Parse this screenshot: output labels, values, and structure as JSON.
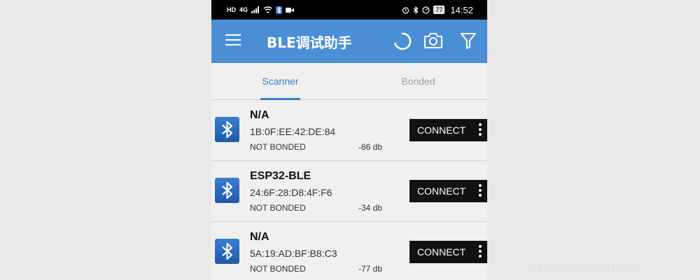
{
  "statusbar": {
    "left_badge": "HD",
    "network": "4G",
    "battery": "77",
    "time": "14:52"
  },
  "appbar": {
    "title": "BLE调试助手",
    "icons": [
      "menu-icon",
      "refresh-spinner-icon",
      "camera-icon",
      "filter-icon"
    ]
  },
  "tabs": [
    {
      "label": "Scanner",
      "active": true
    },
    {
      "label": "Bonded",
      "active": false
    }
  ],
  "devices": [
    {
      "name": "N/A",
      "mac": "1B:0F:EE:42:DE:84",
      "bond": "NOT BONDED",
      "rssi": "-86 db",
      "action": "CONNECT"
    },
    {
      "name": "ESP32-BLE",
      "mac": "24:6F:28:D8:4F:F6",
      "bond": "NOT BONDED",
      "rssi": "-34 db",
      "action": "CONNECT"
    },
    {
      "name": "N/A",
      "mac": "5A:19:AD:BF:B8:C3",
      "bond": "NOT BONDED",
      "rssi": "-77 db",
      "action": "CONNECT"
    }
  ],
  "watermark": "https://blog.csdn.net/Naisu_kun",
  "colors": {
    "appbar": "#4a8fd6",
    "active_tab": "#3a7fcc",
    "button": "#111111"
  }
}
